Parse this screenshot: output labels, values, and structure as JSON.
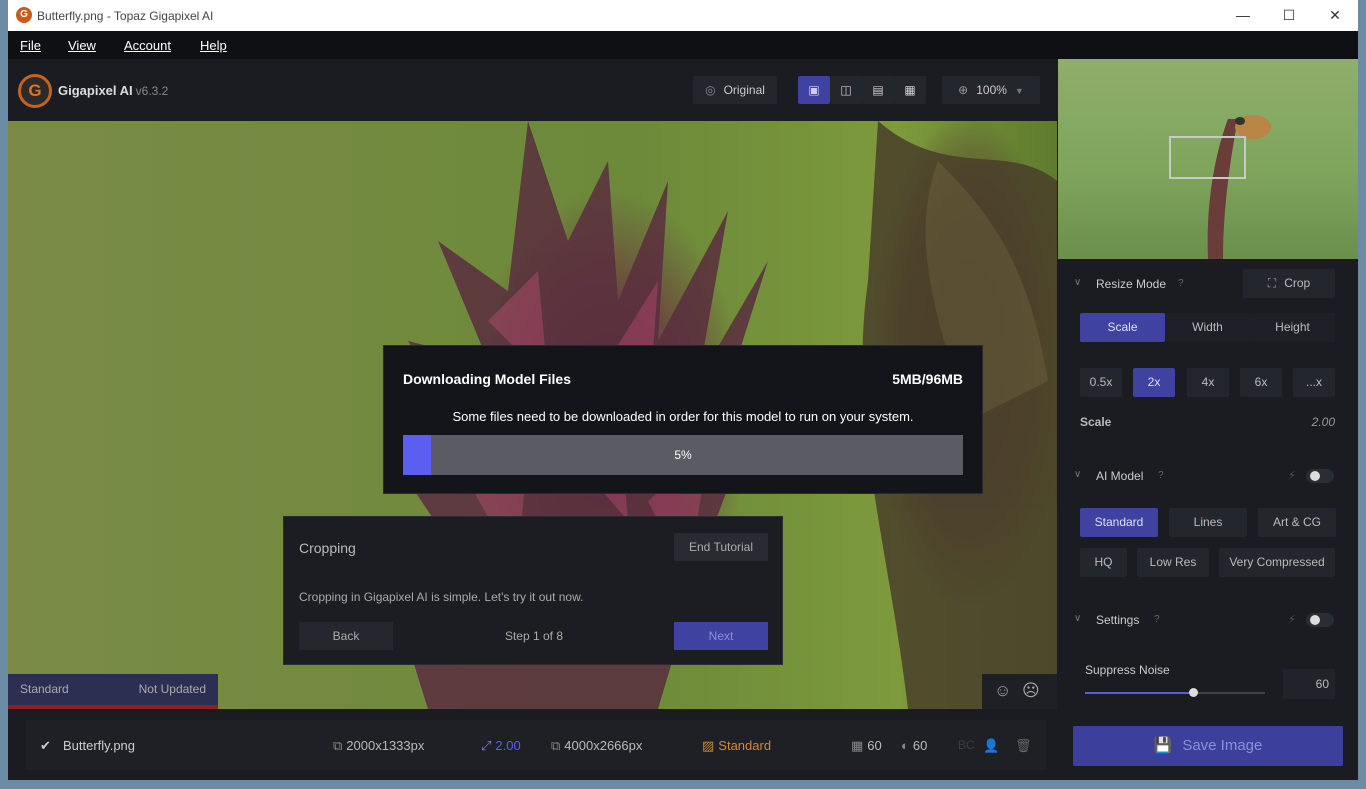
{
  "window": {
    "title": "Butterfly.png - Topaz Gigapixel AI",
    "min": "—",
    "max": "☐",
    "close": "✕"
  },
  "menu": {
    "file": "File",
    "view": "View",
    "account": "Account",
    "help": "Help"
  },
  "app": {
    "name": "Gigapixel AI",
    "version": "v6.3.2",
    "logo_letter": "G"
  },
  "toolbar": {
    "original_label": "Original",
    "zoom": "100%"
  },
  "modal": {
    "title": "Downloading Model Files",
    "size": "5MB/96MB",
    "message": "Some files need to be downloaded in order for this model to run on your system.",
    "progress_label": "5%",
    "progress": 0.05
  },
  "tutorial": {
    "title": "Cropping",
    "end_label": "End Tutorial",
    "text": "Cropping in Gigapixel AI is simple. Let's try it out now.",
    "back_label": "Back",
    "step": "Step 1 of 8",
    "next_label": "Next"
  },
  "status": {
    "model": "Standard",
    "state": "Not Updated"
  },
  "resize": {
    "header": "Resize Mode",
    "help": "?",
    "crop_label": "Crop",
    "modes": [
      "Scale",
      "Width",
      "Height"
    ],
    "scales": [
      "0.5x",
      "2x",
      "4x",
      "6x",
      "...x"
    ],
    "scale_label": "Scale",
    "scale_value": "2.00"
  },
  "aimodel": {
    "header": "AI Model",
    "help": "?",
    "row1": [
      "Standard",
      "Lines",
      "Art & CG"
    ],
    "row2": [
      "HQ",
      "Low Res",
      "Very Compressed"
    ]
  },
  "settings": {
    "header": "Settings",
    "help": "?",
    "suppress_label": "Suppress Noise",
    "suppress_value": "60",
    "suppress_level": 0.6
  },
  "bottom": {
    "filename": "Butterfly.png",
    "input_size": "2000x1333px",
    "scale": "2.00",
    "output_size": "4000x2666px",
    "model": "Standard",
    "noise": "60",
    "blur": "60",
    "fc": "BC"
  },
  "save_label": "Save Image",
  "colors": {
    "accent": "#3f42a0",
    "progress": "#5b5ff0",
    "model_gold": "#d08a30"
  }
}
